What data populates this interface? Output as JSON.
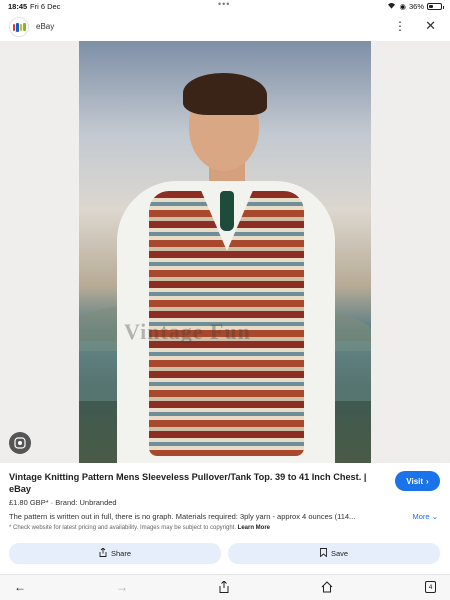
{
  "status_bar": {
    "time": "18:45",
    "date": "Fri 6 Dec",
    "battery": "36%",
    "battery_level": 0.36
  },
  "header": {
    "title": "eBay"
  },
  "image": {
    "watermark": "Vintage Fun"
  },
  "result": {
    "title": "Vintage Knitting Pattern Mens Sleeveless Pullover/Tank Top. 39 to 41 Inch Chest. | eBay",
    "price": "£1.80 GBP*",
    "brand": "Brand: Unbranded",
    "description": "The pattern is written out in full, there is no graph. Materials required: 3ply yarn - approx 4 ounces (114...",
    "more_label": "More",
    "note": "* Check website for latest pricing and availability. Images may be subject to copyright.",
    "learn_more": "Learn More",
    "visit_label": "Visit",
    "share_label": "Share",
    "save_label": "Save"
  },
  "toolbar": {
    "tabs_count": "4"
  },
  "icons": [
    "lens-icon",
    "back-icon",
    "forward-icon",
    "share-icon",
    "home-icon",
    "tabs-icon",
    "close-icon",
    "more-icon",
    "wifi-icon",
    "bookmark-icon"
  ],
  "colors": {
    "accent": "#1a73e8",
    "button_bg": "#e7eefb"
  }
}
